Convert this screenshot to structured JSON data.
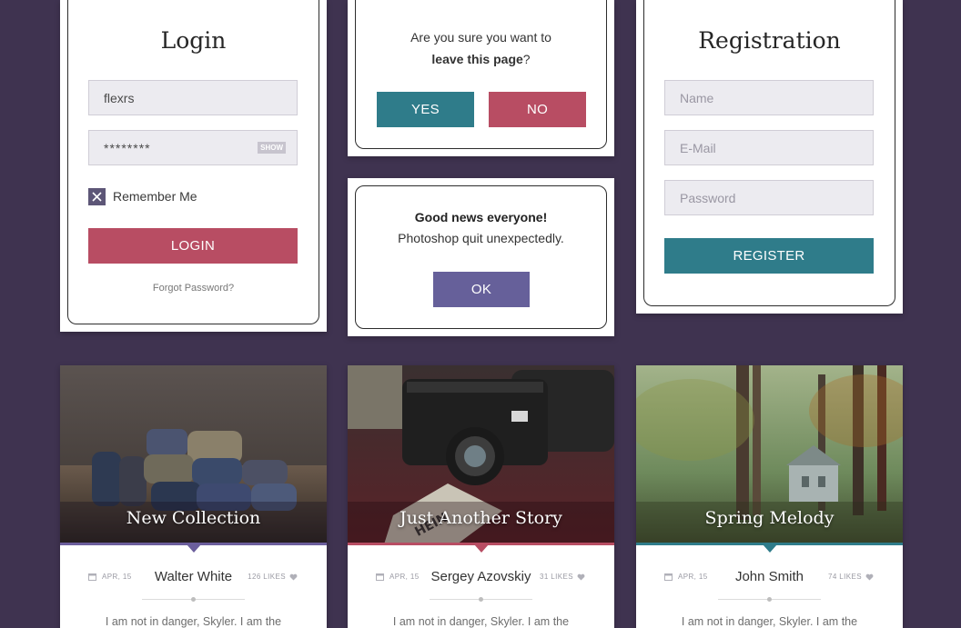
{
  "login": {
    "title": "Login",
    "username_value": "flexrs",
    "password_value": "********",
    "show_label": "SHOW",
    "remember_label": "Remember Me",
    "remember_checked": true,
    "login_button": "LOGIN",
    "forgot_link": "Forgot Password?"
  },
  "confirm": {
    "question_line1": "Are you sure you want to",
    "question_bold": "leave this page",
    "question_end": "?",
    "yes_button": "YES",
    "no_button": "NO"
  },
  "alert": {
    "headline": "Good news everyone!",
    "message": "Photoshop quit unexpectedly.",
    "ok_button": "OK"
  },
  "registration": {
    "title": "Registration",
    "name_placeholder": "Name",
    "email_placeholder": "E-Mail",
    "password_placeholder": "Password",
    "register_button": "REGISTER"
  },
  "stories": [
    {
      "caption": "New Collection",
      "date": "APR, 15",
      "author": "Walter White",
      "likes": "126 LIKES",
      "excerpt": "I am not in danger, Skyler. I am the",
      "accent": "#6b5e9c"
    },
    {
      "caption": "Just Another Story",
      "date": "APR, 15",
      "author": "Sergey Azovskiy",
      "likes": "31 LIKES",
      "excerpt": "I am not in danger, Skyler. I am the",
      "accent": "#b84d63"
    },
    {
      "caption": "Spring Melody",
      "date": "APR, 15",
      "author": "John Smith",
      "likes": "74 LIKES",
      "excerpt": "I am not in danger, Skyler. I am the",
      "accent": "#2f7c8a"
    }
  ],
  "colors": {
    "background": "#3f3350",
    "red": "#b84d63",
    "teal": "#2f7c8a",
    "purple": "#66609a"
  },
  "icons": {
    "checkbox": "x-mark-icon",
    "date": "calendar-icon",
    "likes": "heart-icon"
  }
}
